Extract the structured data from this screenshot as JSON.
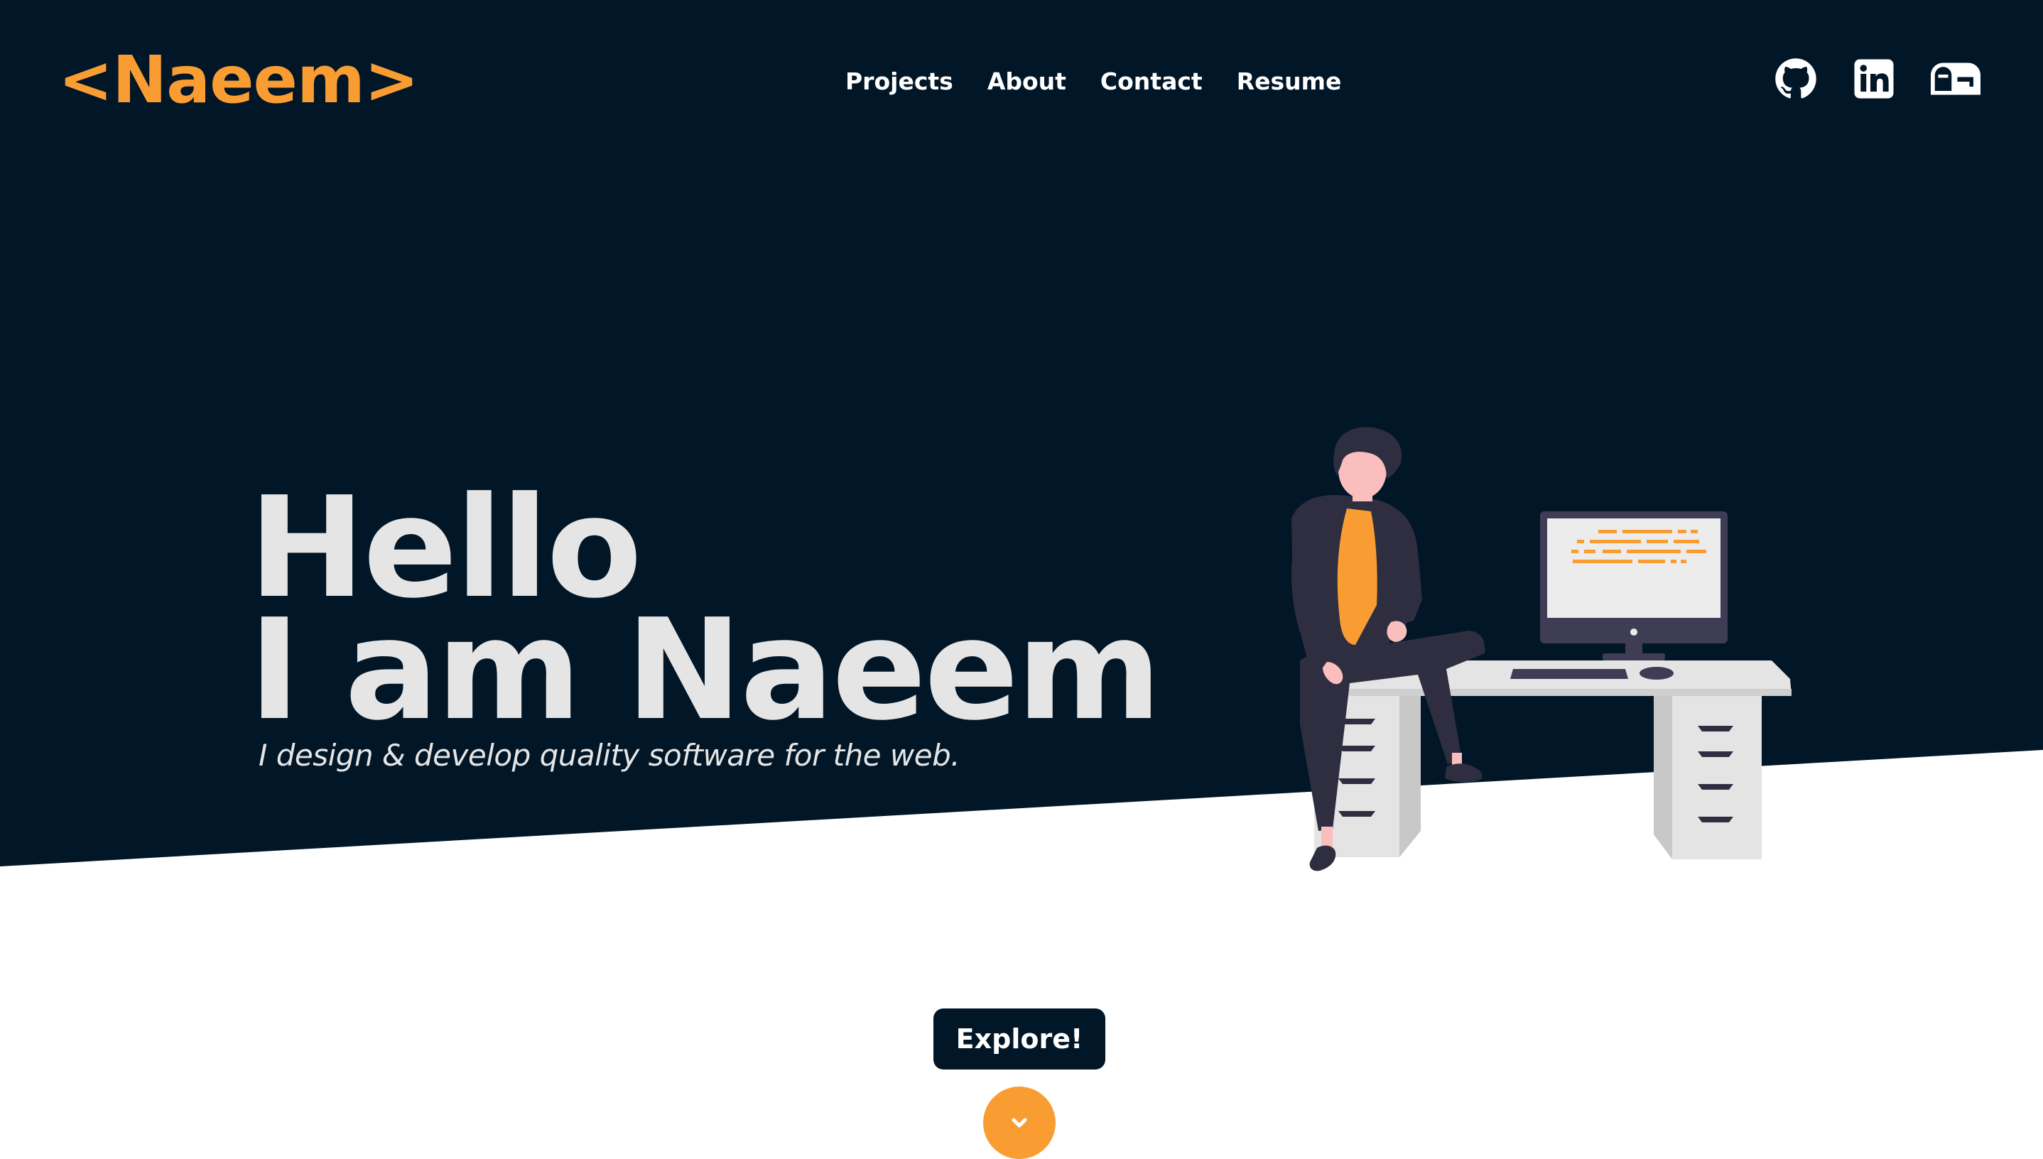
{
  "header": {
    "logo_text": "<Naeem>",
    "nav": [
      "Projects",
      "About",
      "Contact",
      "Resume"
    ],
    "social_icons": [
      "github-icon",
      "linkedin-icon",
      "mailbox-icon"
    ]
  },
  "hero": {
    "line1": "Hello",
    "line2": "I am Naeem",
    "tagline": "I design & develop quality software for the web."
  },
  "cta": {
    "explore_label": "Explore!"
  },
  "colors": {
    "dark": "#011627",
    "accent": "#f99d33",
    "light_text": "#e5e5e5",
    "white": "#ffffff"
  }
}
